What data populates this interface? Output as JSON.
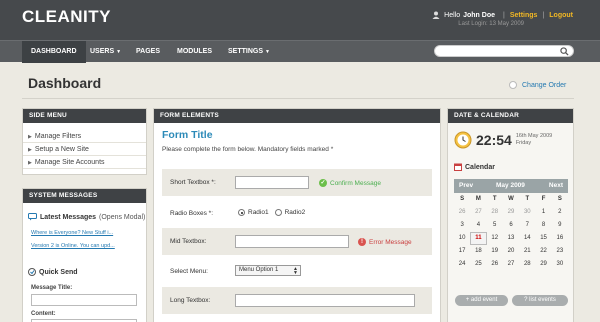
{
  "app": {
    "logo": "CLEANITY"
  },
  "user": {
    "hello": "Hello",
    "name": "John Doe",
    "settings": "Settings",
    "logout": "Logout",
    "last_login": "Last Login: 13 May 2009"
  },
  "nav": {
    "items": [
      {
        "label": "DASHBOARD",
        "active": true
      },
      {
        "label": "USERS",
        "dropdown": true
      },
      {
        "label": "PAGES"
      },
      {
        "label": "MODULES"
      },
      {
        "label": "SETTINGS",
        "dropdown": true
      }
    ],
    "search_placeholder": ""
  },
  "page": {
    "title": "Dashboard",
    "change_order": "Change Order"
  },
  "side_menu": {
    "title": "SIDE MENU",
    "items": [
      "Manage Filters",
      "Setup a New Site",
      "Manage Site Accounts"
    ]
  },
  "system_messages": {
    "title": "SYSTEM MESSAGES",
    "latest_label": "Latest Messages",
    "latest_note": "(Opens Modal)",
    "messages": [
      "Where is Everyone? New Stuff i...",
      "Version 2 is Online. You can upd..."
    ],
    "quick_send": "Quick Send",
    "message_title_label": "Message Title:",
    "content_label": "Content:"
  },
  "form": {
    "title": "FORM ELEMENTS",
    "heading": "Form Title",
    "description": "Please complete the form below. Mandatory fields marked *",
    "short_label": "Short Textbox *:",
    "confirm": "Confirm Message",
    "radio_label": "Radio Boxes *:",
    "radio1": "Radio1",
    "radio2": "Radio2",
    "mid_label": "Mid Textbox:",
    "error": "Error Message",
    "select_label": "Select Menu:",
    "select_value": "Menu Option 1",
    "long_label": "Long Textbox:"
  },
  "calendar": {
    "title": "DATE & CALENDAR",
    "time": "22:54",
    "date_line1": "16th May 2009",
    "date_line2": "Friday",
    "cal_label": "Calendar",
    "prev": "Prev",
    "month": "May 2009",
    "next": "Next",
    "days": [
      "S",
      "M",
      "T",
      "W",
      "T",
      "F",
      "S"
    ],
    "weeks": [
      [
        "26",
        "27",
        "28",
        "29",
        "30",
        "1",
        "2"
      ],
      [
        "3",
        "4",
        "5",
        "6",
        "7",
        "8",
        "9"
      ],
      [
        "10",
        "11",
        "12",
        "13",
        "14",
        "15",
        "16"
      ],
      [
        "17",
        "18",
        "19",
        "20",
        "21",
        "22",
        "23"
      ],
      [
        "24",
        "25",
        "26",
        "27",
        "28",
        "29",
        "30"
      ]
    ],
    "today": "11",
    "add_event": "+ add event",
    "list_events": "? list events"
  },
  "colors": {
    "accent": "#f2b824",
    "heading_blue": "#2c8ab8",
    "link": "#2479b1",
    "dark": "#46494c",
    "success": "#4caf50",
    "error": "#c94040"
  }
}
